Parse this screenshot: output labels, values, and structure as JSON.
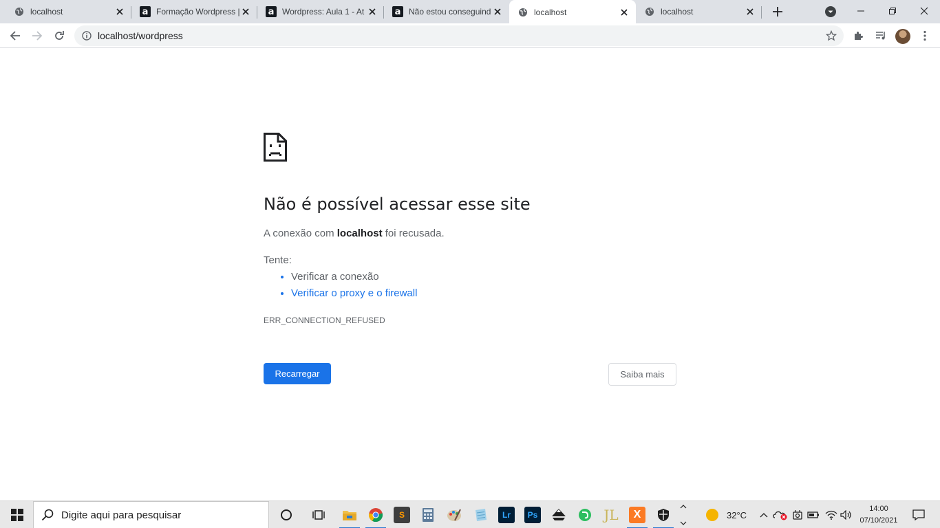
{
  "browser": {
    "tabs": [
      {
        "title": "localhost",
        "favicon": "globe-icon",
        "active": false
      },
      {
        "title": "Formação Wordpress |",
        "favicon": "alura-icon",
        "active": false
      },
      {
        "title": "Wordpress: Aula 1 - At",
        "favicon": "alura-icon",
        "active": false
      },
      {
        "title": "Não estou conseguind",
        "favicon": "alura-icon",
        "active": false
      },
      {
        "title": "localhost",
        "favicon": "globe-icon",
        "active": true
      },
      {
        "title": "localhost",
        "favicon": "globe-icon",
        "active": false
      }
    ],
    "url": "localhost/wordpress",
    "favicon_letter": "a"
  },
  "error_page": {
    "heading": "Não é possível acessar esse site",
    "message_prefix": "A conexão com ",
    "message_host": "localhost",
    "message_suffix": " foi recusada.",
    "try_label": "Tente:",
    "suggestions": [
      "Verificar a conexão",
      "Verificar o proxy e o firewall"
    ],
    "error_code": "ERR_CONNECTION_REFUSED",
    "reload_label": "Recarregar",
    "more_label": "Saiba mais"
  },
  "taskbar": {
    "search_placeholder": "Digite aqui para pesquisar",
    "apps": [
      {
        "name": "file-explorer",
        "label": ""
      },
      {
        "name": "chrome",
        "label": ""
      },
      {
        "name": "sublime-text",
        "label": "S"
      },
      {
        "name": "calculator",
        "label": ""
      },
      {
        "name": "paint",
        "label": ""
      },
      {
        "name": "notepad",
        "label": ""
      },
      {
        "name": "lightroom",
        "label": "Lr"
      },
      {
        "name": "photoshop",
        "label": "Ps"
      },
      {
        "name": "inkscape",
        "label": ""
      },
      {
        "name": "evernote",
        "label": ""
      },
      {
        "name": "jl-app",
        "label": "JL"
      },
      {
        "name": "xampp",
        "label": "X"
      },
      {
        "name": "security",
        "label": ""
      }
    ],
    "weather": "32°C",
    "time": "14:00",
    "date": "07/10/2021"
  },
  "colors": {
    "accent": "#1a73e8",
    "tab_strip": "#dee1e6",
    "text_secondary": "#5f6368"
  }
}
